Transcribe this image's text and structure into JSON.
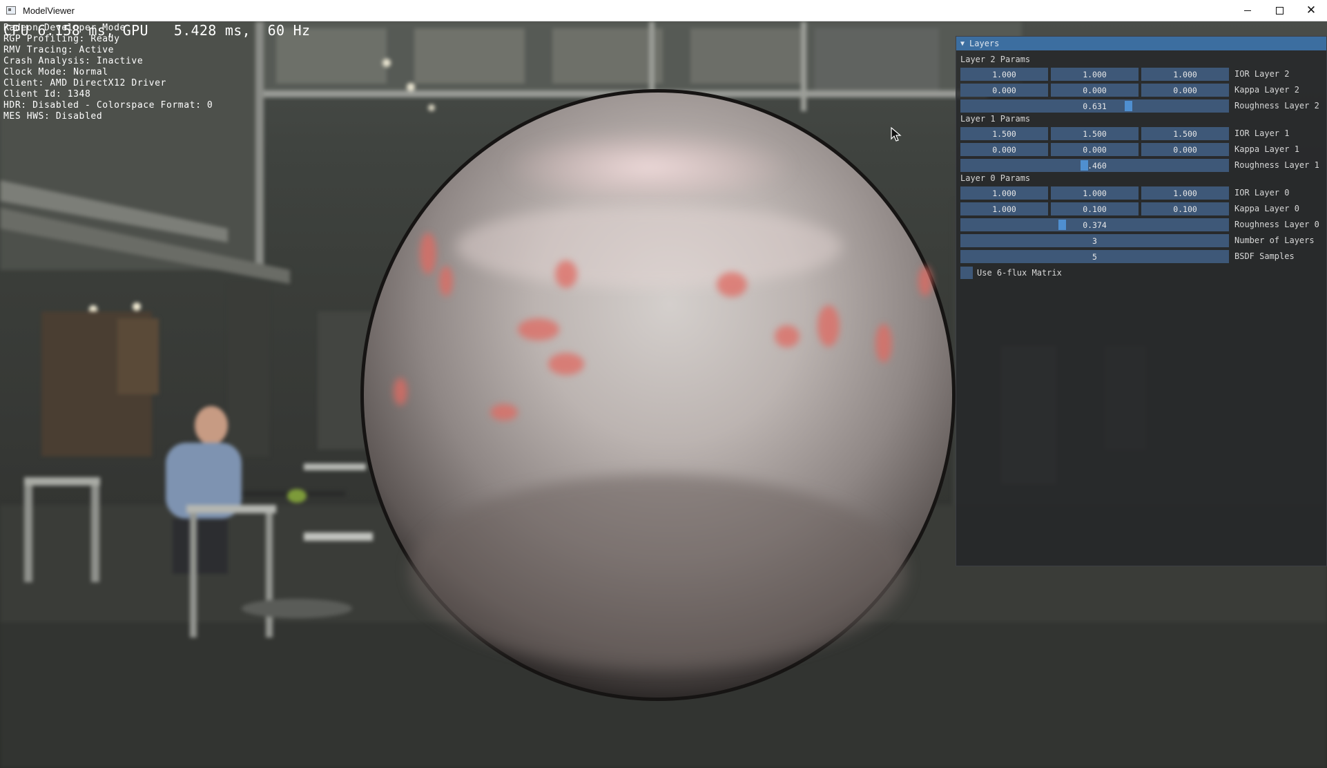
{
  "window": {
    "title": "ModelViewer",
    "controls": {
      "minimize": "minimize-icon",
      "maximize": "maximize-icon",
      "close": "close-icon"
    }
  },
  "overlay": {
    "fps_line": {
      "fps_prefix": "CPU",
      "fps_value": "6.158 ms,",
      "gpu_label": "GPU",
      "gpu_ms": "5.428 ms,",
      "refresh": "60 Hz"
    },
    "lines": [
      "Radeon Developer Mode",
      "RGP Profiling: Ready",
      "RMV Tracing: Active",
      "Crash Analysis: Inactive",
      "Clock Mode: Normal",
      "Client: AMD DirectX12 Driver",
      "Client Id: 1348",
      "HDR: Disabled - Colorspace Format: 0",
      "MES HWS: Disabled"
    ]
  },
  "layers_panel": {
    "title": "Layers",
    "layer2": {
      "heading": "Layer 2 Params",
      "ior": {
        "values": [
          "1.000",
          "1.000",
          "1.000"
        ],
        "label": "IOR Layer 2"
      },
      "kappa": {
        "values": [
          "0.000",
          "0.000",
          "0.000"
        ],
        "label": "Kappa Layer 2"
      },
      "roughness": {
        "value": "0.631",
        "level": 0.631,
        "label": "Roughness Layer 2"
      }
    },
    "layer1": {
      "heading": "Layer 1 Params",
      "ior": {
        "values": [
          "1.500",
          "1.500",
          "1.500"
        ],
        "label": "IOR Layer 1"
      },
      "kappa": {
        "values": [
          "0.000",
          "0.000",
          "0.000"
        ],
        "label": "Kappa Layer 1"
      },
      "roughness": {
        "value": "0.460",
        "level": 0.46,
        "label": "Roughness Layer 1"
      }
    },
    "layer0": {
      "heading": "Layer 0 Params",
      "ior": {
        "values": [
          "1.000",
          "1.000",
          "1.000"
        ],
        "label": "IOR Layer 0"
      },
      "kappa": {
        "values": [
          "1.000",
          "0.100",
          "0.100"
        ],
        "label": "Kappa Layer 0"
      },
      "roughness": {
        "value": "0.374",
        "level": 0.374,
        "label": "Roughness Layer 0"
      }
    },
    "num_layers": {
      "value": "3",
      "label": "Number of Layers"
    },
    "bsdf_samples": {
      "value": "5",
      "label": "BSDF Samples"
    },
    "six_flux": {
      "label": "Use 6-flux Matrix",
      "checked": false
    }
  },
  "colors": {
    "panel_header": "#3c6ea0",
    "field_bg": "#3e5878",
    "slider_grab": "#4f8fd0"
  }
}
